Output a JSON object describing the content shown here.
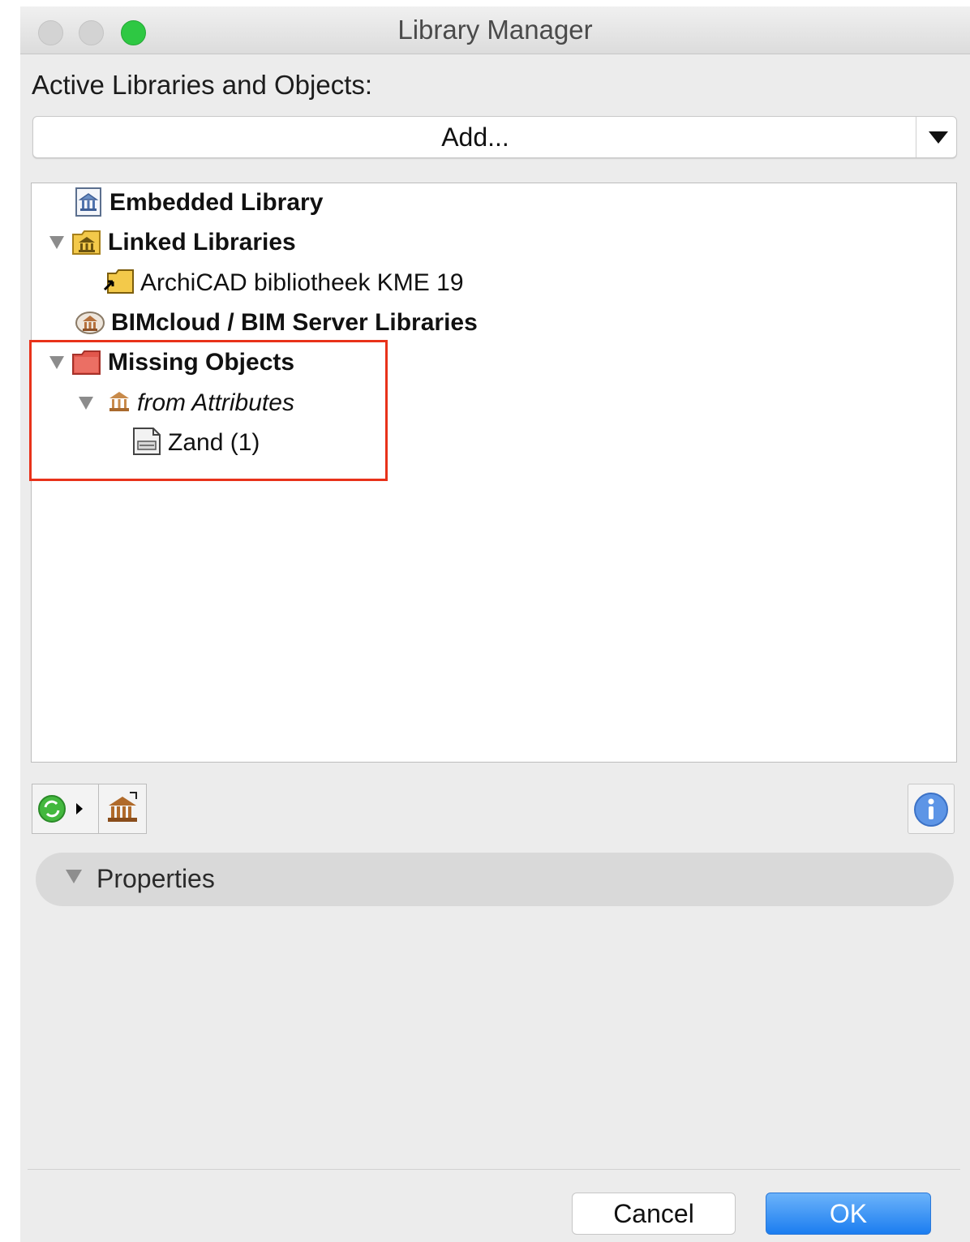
{
  "window": {
    "title": "Library Manager"
  },
  "active_libraries": {
    "label": "Active Libraries and Objects:",
    "add_button_label": "Add..."
  },
  "tree": {
    "items": [
      {
        "label": "Embedded Library",
        "icon": "embedded-library-icon",
        "style": "bold",
        "expanded": null
      },
      {
        "label": "Linked Libraries",
        "icon": "linked-libraries-folder-icon",
        "style": "bold",
        "expanded": true
      },
      {
        "label": "ArchiCAD bibliotheek KME 19",
        "icon": "linked-library-folder-icon",
        "style": "normal",
        "expanded": null
      },
      {
        "label": "BIMcloud / BIM Server Libraries",
        "icon": "bimcloud-library-icon",
        "style": "bold",
        "expanded": null
      },
      {
        "label": "Missing Objects",
        "icon": "missing-objects-folder-icon",
        "style": "bold",
        "expanded": true
      },
      {
        "label": "from Attributes",
        "icon": "attributes-library-icon",
        "style": "italic",
        "expanded": true
      },
      {
        "label": "Zand (1)",
        "icon": "object-file-icon",
        "style": "normal",
        "expanded": null
      }
    ]
  },
  "toolbar": {
    "reload_icon": "reload-icon",
    "library_icon": "library-settings-icon",
    "info_icon": "info-icon"
  },
  "properties": {
    "label": "Properties",
    "expanded": true
  },
  "buttons": {
    "cancel": "Cancel",
    "ok": "OK"
  },
  "colors": {
    "highlight_box": "#e8321a",
    "ok_button": "#1b7df0",
    "zoom_light": "#2ec843"
  }
}
